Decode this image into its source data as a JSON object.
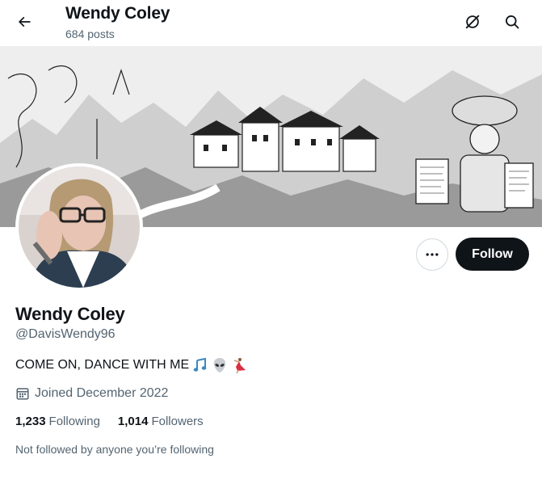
{
  "header": {
    "title": "Wendy Coley",
    "post_count": "684 posts",
    "back_icon": "arrow-left-icon",
    "grok_icon": "grok-icon",
    "search_icon": "search-icon"
  },
  "profile": {
    "display_name": "Wendy Coley",
    "handle": "@DavisWendy96",
    "bio_text": "COME ON, DANCE WITH ME",
    "bio_emojis": [
      "musical-notes-icon",
      "alien-icon",
      "dancer-icon"
    ],
    "joined": "Joined December 2022",
    "calendar_icon": "calendar-icon",
    "following_count": "1,233",
    "following_label": "Following",
    "followers_count": "1,014",
    "followers_label": "Followers",
    "followed_by_note": "Not followed by anyone you’re following"
  },
  "actions": {
    "more_icon": "more-dots-icon",
    "follow_label": "Follow"
  },
  "colors": {
    "text_primary": "#0f1419",
    "text_secondary": "#536471",
    "button_dark": "#0f1419",
    "border": "#cfd9de"
  }
}
